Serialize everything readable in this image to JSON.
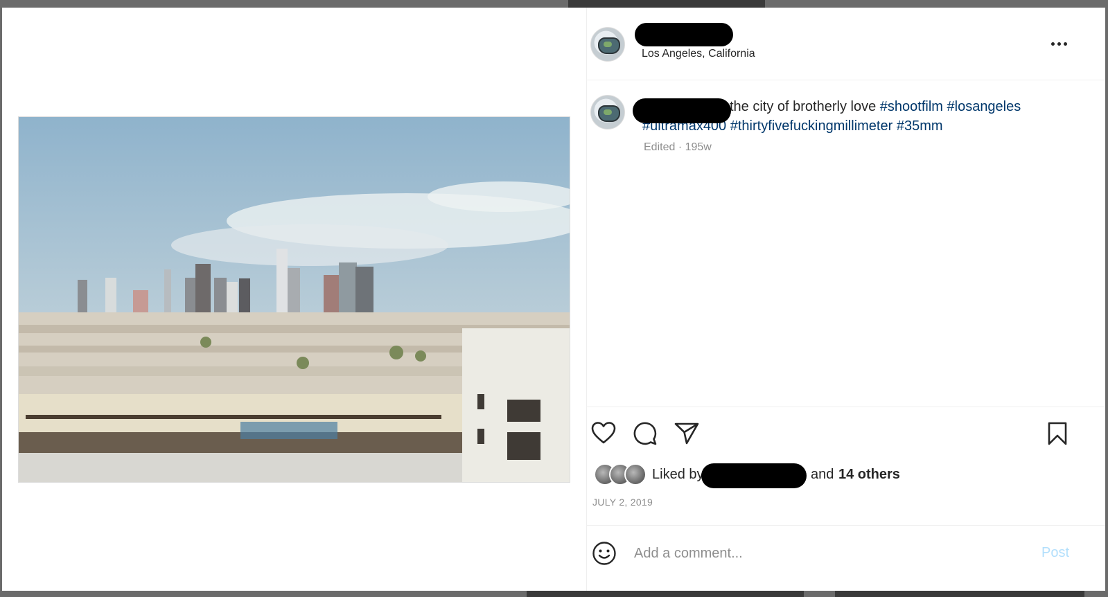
{
  "post": {
    "location": "Los Angeles, California",
    "caption": {
      "text": "the city of brotherly love ",
      "hashtags": [
        "#shootfilm",
        "#losangeles",
        "#ultramax400",
        "#thirtyfivefuckingmillimeter",
        "#35mm"
      ]
    },
    "meta": "Edited · 195w",
    "likes": {
      "prefix": "Liked by",
      "middle": "and",
      "others": "14 others"
    },
    "date": "JULY 2, 2019"
  },
  "comment": {
    "placeholder": "Add a comment...",
    "post_label": "Post"
  },
  "icons": {
    "more": "more-options-icon",
    "like": "heart-icon",
    "comment": "comment-bubble-icon",
    "share": "paper-plane-icon",
    "save": "bookmark-icon",
    "emoji": "emoji-icon"
  },
  "colors": {
    "hashtag": "#00376b",
    "post_button": "#b2dffc",
    "muted": "#8e8e8e"
  }
}
